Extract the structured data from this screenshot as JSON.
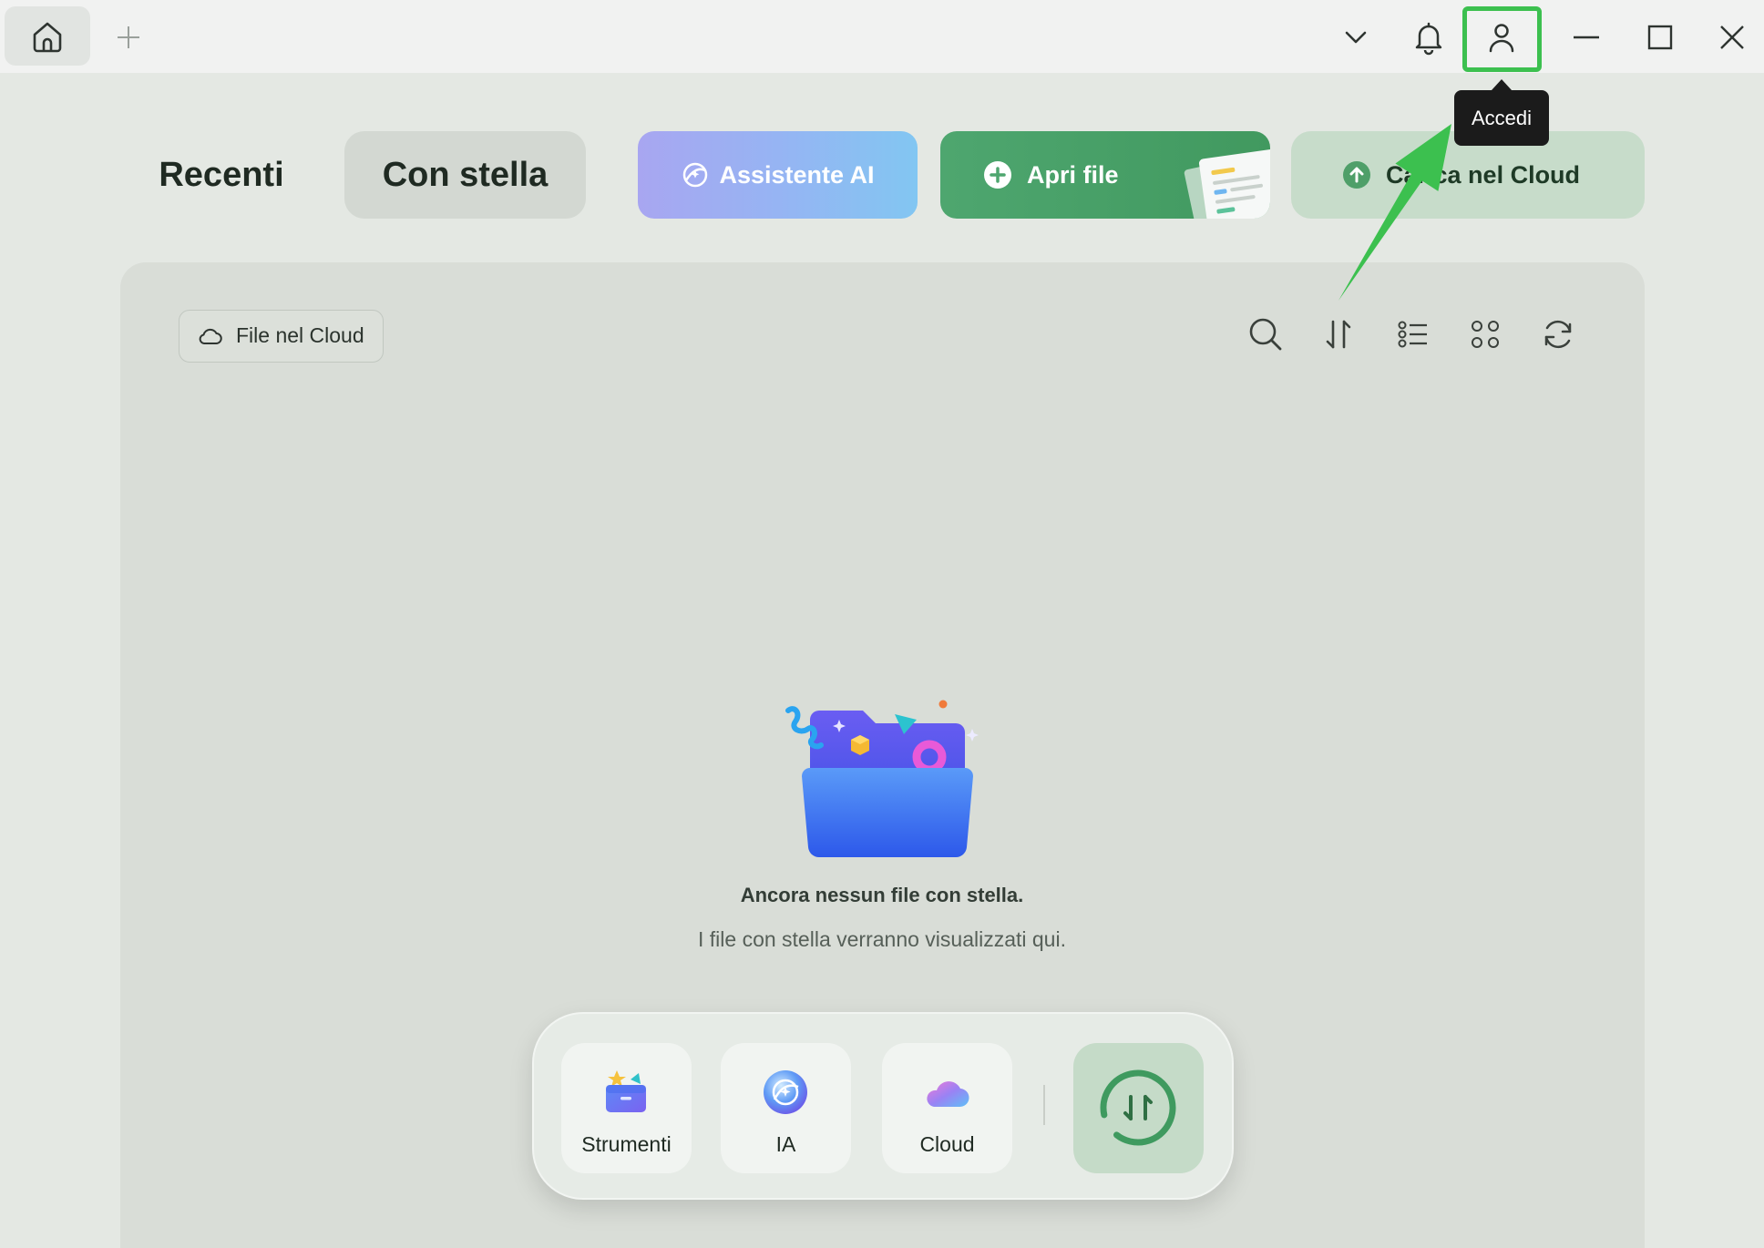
{
  "window": {
    "home_tab_icon": "home-icon",
    "new_tab_icon": "plus-icon",
    "controls": [
      "chevron-down-icon",
      "bell-icon",
      "user-icon",
      "minimize-icon",
      "maximize-icon",
      "close-icon"
    ]
  },
  "tooltip": {
    "text": "Accedi"
  },
  "tabs": [
    {
      "label": "Recenti",
      "active": false
    },
    {
      "label": "Con stella",
      "active": true
    }
  ],
  "actions": {
    "ai": {
      "label": "Assistente AI",
      "icon": "ai-assistant-icon"
    },
    "open": {
      "label": "Apri file",
      "icon": "plus-circle-icon"
    },
    "upload": {
      "label": "Carica nel Cloud",
      "icon": "upload-circle-icon"
    }
  },
  "panel": {
    "filter_chip": {
      "label": "File nel Cloud",
      "icon": "cloud-outline-icon"
    },
    "toolbar": [
      "search-icon",
      "sort-icon",
      "list-view-icon",
      "grid-view-icon",
      "refresh-icon"
    ]
  },
  "empty_state": {
    "title": "Ancora nessun file con stella.",
    "subtitle": "I file con stella verranno visualizzati qui.",
    "illustration": "empty-folder-illustration"
  },
  "dock": {
    "items": [
      {
        "label": "Strumenti",
        "icon": "toolbox-icon"
      },
      {
        "label": "IA",
        "icon": "ai-orb-icon"
      },
      {
        "label": "Cloud",
        "icon": "cloud-icon"
      }
    ],
    "convert_icon": "convert-icon"
  },
  "annotation": {
    "highlight_target": "user-icon",
    "color": "#3cc04f"
  },
  "colors": {
    "accent_green": "#4ea66f",
    "upload_bg": "#c7dcca",
    "panel_bg": "#d9ddd7",
    "page_bg": "#e4e8e3"
  }
}
